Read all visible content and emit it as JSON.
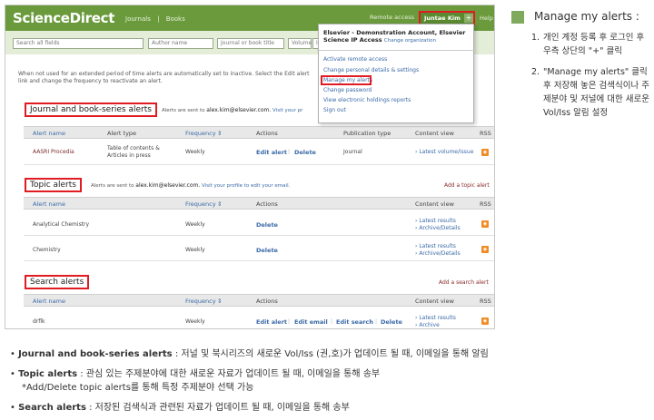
{
  "header": {
    "logo": "ScienceDirect",
    "nav": [
      "Journals",
      "Books"
    ],
    "remote_access": "Remote access",
    "user": "Juntae Kim",
    "plus": "+",
    "help": "Help"
  },
  "search": {
    "all_fields": "Search all fields",
    "author": "Author name",
    "journal": "Journal or book title",
    "volume": "Volume",
    "issue": "Is"
  },
  "intro": "When not used for an extended period of time alerts are automatically set to inactive. Select the Edit alert link and change the frequency to reactivate an alert.",
  "dropdown": {
    "account": "Elsevier - Demonstration Account, Elsevier Science IP Access",
    "change_org": "Change organization",
    "items": [
      "Activate remote access",
      "Change personal details & settings",
      "Manage my alerts",
      "Change password",
      "View electronic holdings reports",
      "Sign out"
    ]
  },
  "journal_section": {
    "title": "Journal and book-series alerts",
    "sent_prefix": "Alerts are sent to",
    "email": "alex.kim@elsevier.com.",
    "visit": "Visit your pr",
    "headers": [
      "Alert name",
      "Alert type",
      "Frequency",
      "Actions",
      "Publication type",
      "Content view",
      "RSS"
    ],
    "row": {
      "name": "AASRI Procedia",
      "type": "Table of contents & Articles in press",
      "frequency": "Weekly",
      "edit": "Edit alert",
      "delete": "Delete",
      "pubtype": "Journal",
      "content": "Latest volume/issue"
    }
  },
  "topic_section": {
    "title": "Topic alerts",
    "sent_prefix": "Alerts are sent to",
    "email": "alex.kim@elsevier.com.",
    "visit": "Visit your profile to edit your email.",
    "add": "Add a topic alert",
    "headers": [
      "Alert name",
      "Frequency",
      "Actions",
      "Content view",
      "RSS"
    ],
    "rows": [
      {
        "name": "Analytical Chemistry",
        "frequency": "Weekly",
        "delete": "Delete",
        "latest": "Latest results",
        "archive": "Archive/Details"
      },
      {
        "name": "Chemistry",
        "frequency": "Weekly",
        "delete": "Delete",
        "latest": "Latest results",
        "archive": "Archive/Details"
      }
    ]
  },
  "search_section": {
    "title": "Search alerts",
    "add": "Add a search alert",
    "headers": [
      "Alert name",
      "Frequency",
      "Actions",
      "Content view",
      "RSS"
    ],
    "row": {
      "name": "drflk",
      "frequency": "Weekly",
      "edit": "Edit alert",
      "email": "Edit email",
      "editsearch": "Edit search",
      "delete": "Delete",
      "latest": "Latest results",
      "archive": "Archive"
    }
  },
  "right_panel": {
    "title": "Manage my alerts :",
    "steps": [
      {
        "num": "1.",
        "text": "개인 계정 등록 후 로그인 후 우측 상단의 \"+\" 클릭"
      },
      {
        "num": "2.",
        "text": "\"Manage my alerts\" 클릭 후 저장해 놓은 검색식이나 주제분야 및 저널에 대한 새로운 Vol/Iss 알림 설정"
      }
    ]
  },
  "bullets": [
    {
      "bold": "Journal and book-series alerts",
      "text": " : 저널 및 북시리즈의 새로운 Vol/Iss (권,호)가 업데이트 될 때, 이메일을 통해 알림"
    },
    {
      "bold": "Topic alerts",
      "text": " : 관심 있는 주제분야에 대한 새로운 자료가 업데이트 될 때, 이메일을 통해 송부"
    },
    {
      "bold": "",
      "text": "*Add/Delete topic alerts를 통해 특정 주제분야 선택 가능"
    },
    {
      "bold": "Search alerts",
      "text": " : 저장된 검색식과 관련된 자료가 업데이트 될 때, 이메일을 통해 송부"
    }
  ],
  "colors": {
    "brand_green": "#6a9a3c",
    "highlight_red": "#e01b22",
    "link_blue": "#3a6aa8",
    "rss_orange": "#f08a24"
  }
}
